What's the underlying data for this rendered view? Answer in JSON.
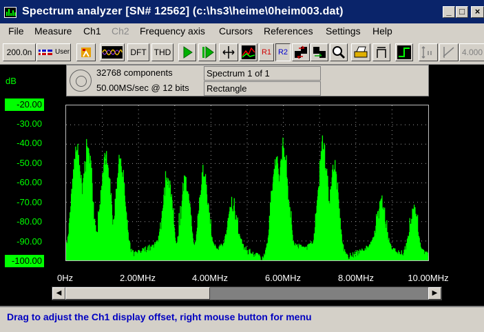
{
  "window": {
    "title": "Spectrum analyzer [SN# 12562] (c:\\hs3\\heime\\0heim003.dat)",
    "minimize": "_",
    "maximize": "□",
    "close": "×"
  },
  "menu": {
    "file": "File",
    "measure": "Measure",
    "ch1": "Ch1",
    "ch2": "Ch2",
    "frequency_axis": "Frequency axis",
    "cursors": "Cursors",
    "references": "References",
    "settings": "Settings",
    "help": "Help"
  },
  "toolbar": {
    "timebase": "200.0n",
    "user": "User",
    "dft": "DFT",
    "thd": "THD",
    "r1": "R1",
    "r2": "R2",
    "zoom_value": "4.000"
  },
  "info": {
    "components": "32768 components",
    "sample_rate": "50.00MS/sec @ 12 bits",
    "spectrum": "Spectrum 1 of 1",
    "window": "Rectangle"
  },
  "status": {
    "text": "Drag to adjust the Ch1 display offset, right mouse button for menu"
  },
  "colors": {
    "trace": "#00ff00",
    "background": "#000000",
    "face": "#d4d0c8",
    "title_bar": "#0a246a",
    "status_text": "#0000c0"
  },
  "chart_data": {
    "type": "line",
    "y_unit": "dB",
    "x_unit": "MHz",
    "ylim": [
      -100,
      -20
    ],
    "xlim": [
      0,
      10
    ],
    "yticks": [
      "-20.00",
      "-30.00",
      "-40.00",
      "-50.00",
      "-60.00",
      "-70.00",
      "-80.00",
      "-90.00",
      "-100.00"
    ],
    "xticks": [
      "0Hz",
      "2.00MHz",
      "4.00MHz",
      "6.00MHz",
      "8.00MHz",
      "10.00MHz"
    ],
    "grid": true,
    "peaks": [
      {
        "x": 0.3,
        "y": -47
      },
      {
        "x": 0.6,
        "y": -45
      },
      {
        "x": 1.1,
        "y": -48
      },
      {
        "x": 1.5,
        "y": -52
      },
      {
        "x": 2.8,
        "y": -60
      },
      {
        "x": 3.3,
        "y": -62
      },
      {
        "x": 3.8,
        "y": -58
      },
      {
        "x": 4.6,
        "y": -75
      },
      {
        "x": 5.8,
        "y": -52
      },
      {
        "x": 6.0,
        "y": -45
      },
      {
        "x": 7.1,
        "y": -43
      },
      {
        "x": 7.4,
        "y": -55
      },
      {
        "x": 8.7,
        "y": -75
      },
      {
        "x": 9.6,
        "y": -78
      }
    ]
  }
}
